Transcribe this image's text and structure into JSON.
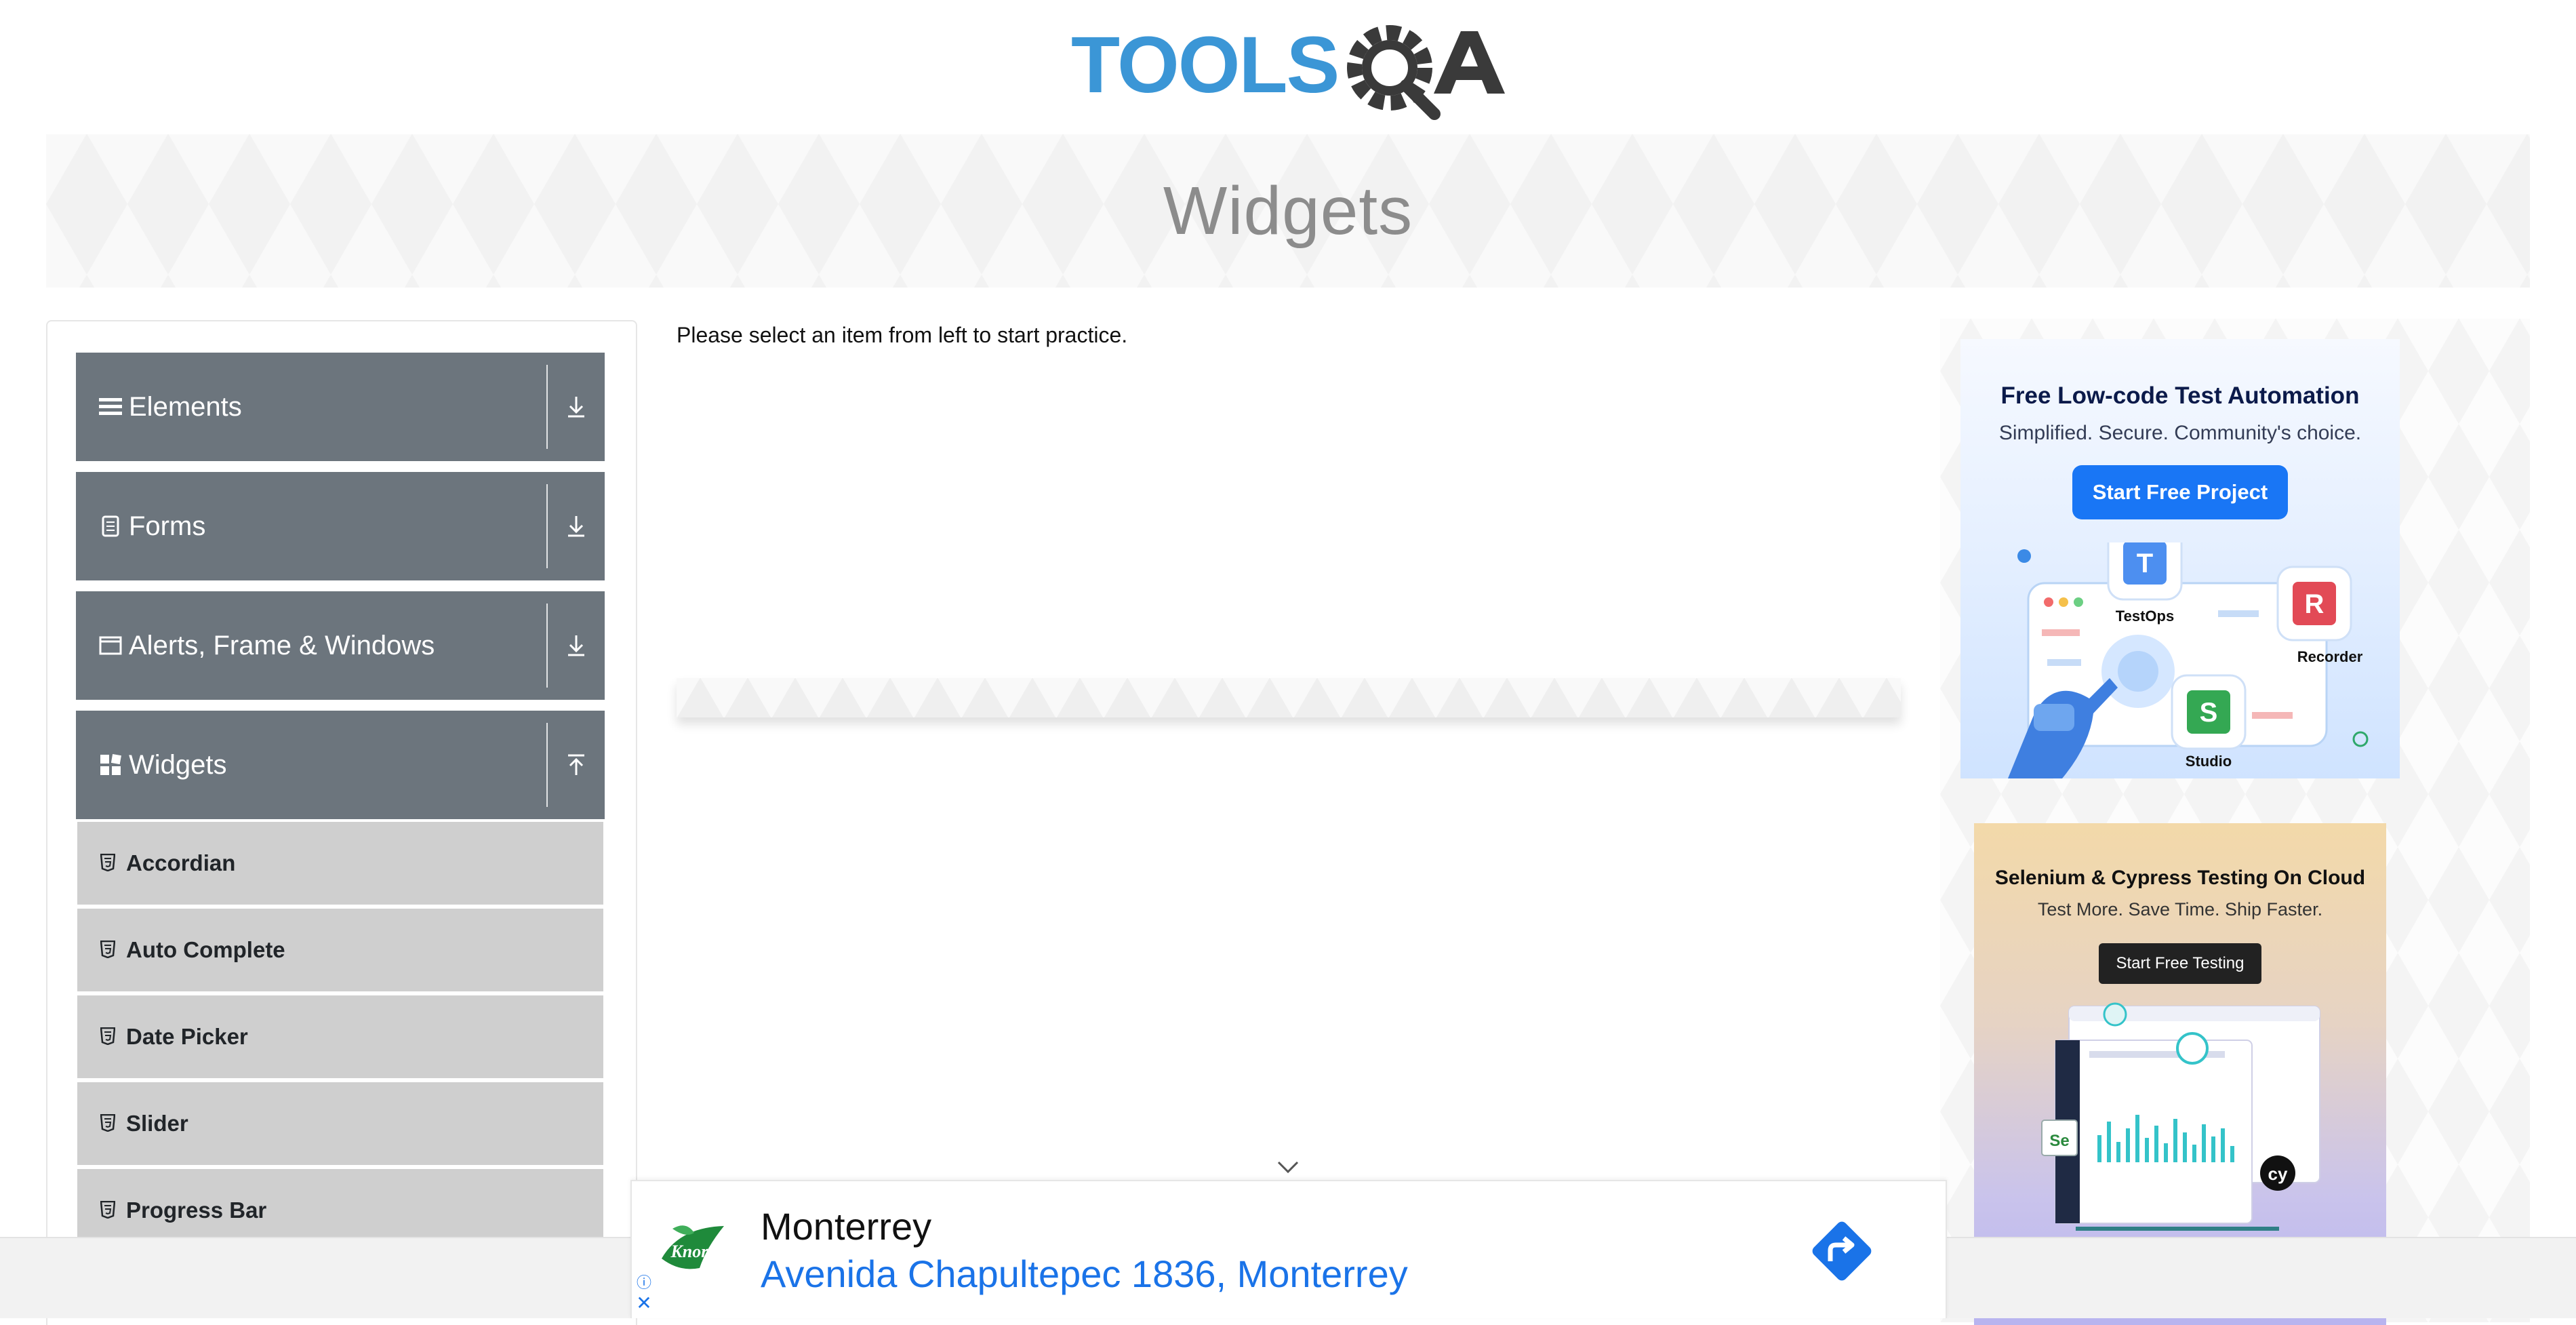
{
  "brand": {
    "name": "TOOLSQA",
    "name_blue": "TOOLS",
    "name_dark": "QA"
  },
  "banner": {
    "title": "Widgets"
  },
  "sidebar": {
    "groups": [
      {
        "label": "Elements",
        "icon": "menu-icon",
        "expanded": false
      },
      {
        "label": "Forms",
        "icon": "document-icon",
        "expanded": false
      },
      {
        "label": "Alerts, Frame & Windows",
        "icon": "window-icon",
        "expanded": false
      },
      {
        "label": "Widgets",
        "icon": "widgets-icon",
        "expanded": true
      }
    ],
    "widget_items": [
      {
        "label": "Accordian"
      },
      {
        "label": "Auto Complete"
      },
      {
        "label": "Date Picker"
      },
      {
        "label": "Slider"
      },
      {
        "label": "Progress Bar"
      }
    ]
  },
  "main": {
    "instruction": "Please select an item from left to start practice."
  },
  "ads": {
    "katalon": {
      "title": "Free Low-code Test Automation",
      "subtitle": "Simplified. Secure. Community's choice.",
      "button": "Start Free Project",
      "labels": {
        "testops": "TestOps",
        "recorder": "Recorder",
        "studio": "Studio"
      },
      "letters": {
        "testops": "T",
        "recorder": "R",
        "studio": "S"
      }
    },
    "lambdatest": {
      "title": "Selenium & Cypress Testing On Cloud",
      "subtitle": "Test More. Save Time. Ship Faster.",
      "button": "Start Free Testing",
      "badges": {
        "selenium": "Se",
        "cypress": "cy"
      }
    },
    "bottom": {
      "brand": "Knorr",
      "place": "Monterrey",
      "address": "Avenida Chapultepec 1836, Monterrey",
      "info_glyph": "ⓘ",
      "close_glyph": "✕"
    }
  },
  "colors": {
    "sidebar_header": "#6c757d",
    "sidebar_item": "#cfcfcf",
    "logo_blue": "#3b96d6",
    "logo_dark": "#3a3a3a",
    "link_blue": "#1a73e8"
  }
}
